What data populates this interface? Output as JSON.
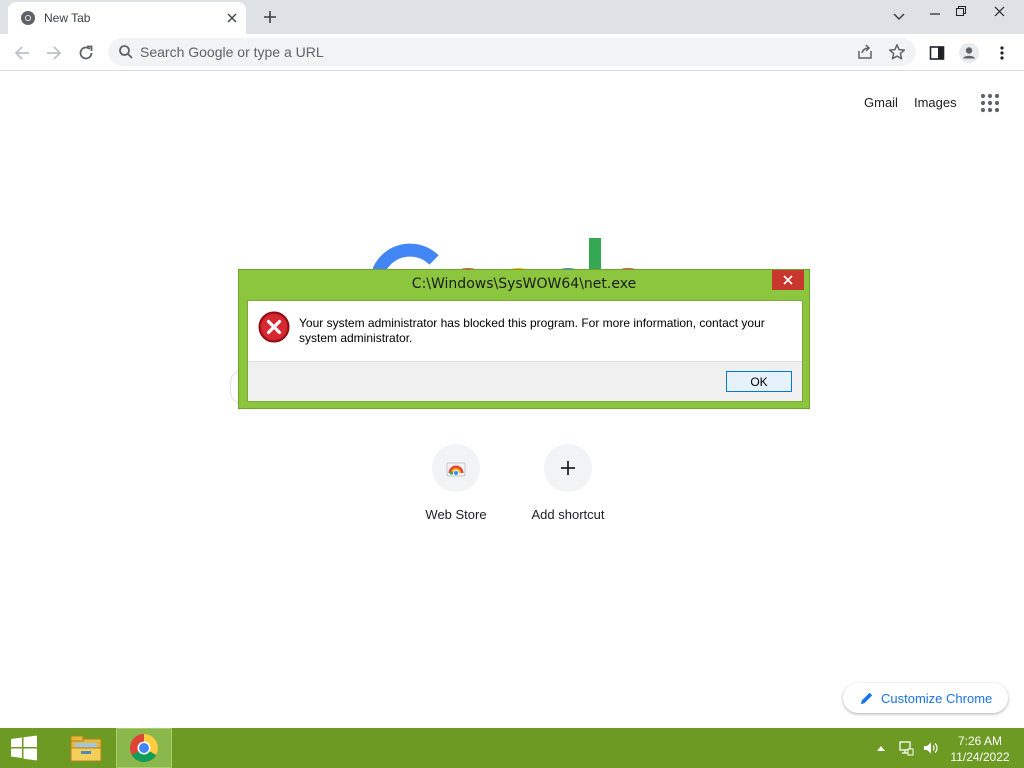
{
  "browser": {
    "tab": {
      "title": "New Tab"
    },
    "omnibox": {
      "placeholder": "Search Google or type a URL"
    }
  },
  "ntp": {
    "links": {
      "gmail": "Gmail",
      "images": "Images"
    },
    "logo_text": "Google",
    "shortcuts": [
      {
        "label": "Web Store",
        "icon": "web-store-icon"
      },
      {
        "label": "Add shortcut",
        "icon": "plus-icon"
      }
    ],
    "customize_label": "Customize Chrome"
  },
  "dialog": {
    "title": "C:\\Windows\\SysWOW64\\net.exe",
    "message": "Your system administrator has blocked this program. For more information, contact your system administrator.",
    "ok_label": "OK",
    "icon": "error-icon"
  },
  "taskbar": {
    "time": "7:26 AM",
    "date": "11/24/2022",
    "apps": [
      "file-explorer-icon",
      "chrome-icon"
    ]
  },
  "colors": {
    "taskbar": "#6c9a23",
    "dialog_frame": "#8cc63f",
    "dialog_close": "#c7372f",
    "link_blue": "#1a73e8"
  }
}
